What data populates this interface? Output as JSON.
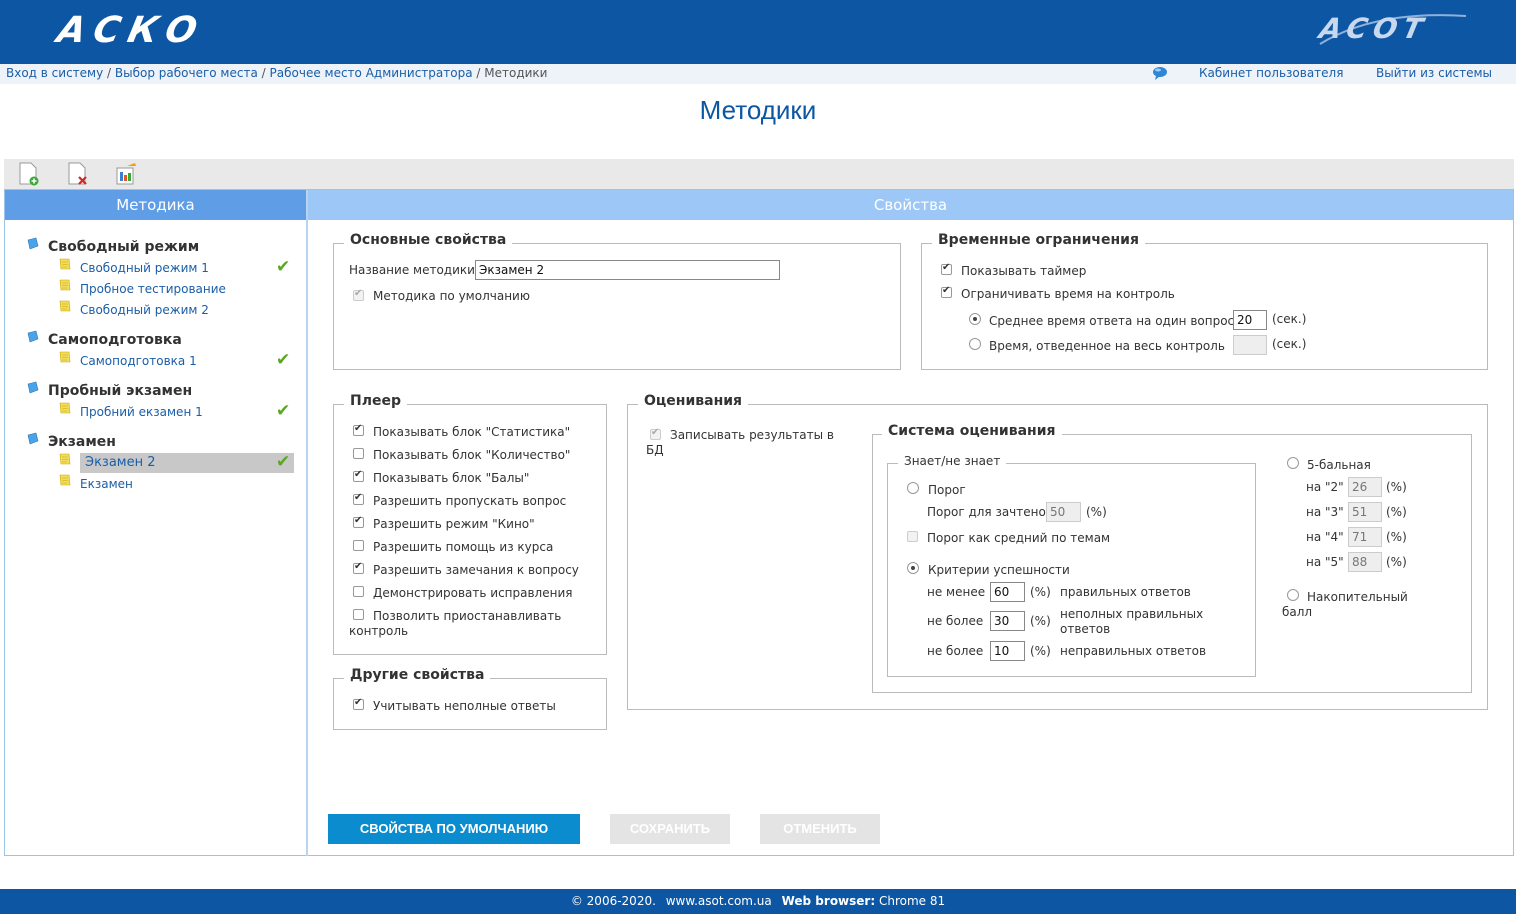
{
  "header": {
    "logo_left": "АСКО",
    "logo_right": "ACOT"
  },
  "breadcrumb": {
    "items": [
      "Вход в систему",
      "Выбор рабочего места",
      "Рабочее место Администратора"
    ],
    "current": "Методики",
    "separator": "/"
  },
  "nav": {
    "cabinet": "Кабинет пользователя",
    "logout": "Выйти из системы"
  },
  "page_title": "Методики",
  "panels": {
    "left_header": "Методика",
    "right_header": "Свойства"
  },
  "tree": [
    {
      "group": "Свободный режим",
      "items": [
        {
          "label": "Свободный режим 1",
          "checked": true
        },
        {
          "label": "Пробное тестирование",
          "checked": false
        },
        {
          "label": "Свободный режим 2",
          "checked": false
        }
      ]
    },
    {
      "group": "Самоподготовка",
      "items": [
        {
          "label": "Самоподготовка 1",
          "checked": true
        }
      ]
    },
    {
      "group": "Пробный экзамен",
      "items": [
        {
          "label": "Пробний екзамен 1",
          "checked": true
        }
      ]
    },
    {
      "group": "Экзамен",
      "items": [
        {
          "label": "Экзамен 2",
          "checked": true,
          "selected": true
        },
        {
          "label": "Екзамен",
          "checked": false
        }
      ]
    }
  ],
  "basic": {
    "title": "Основные свойства",
    "name_label": "Название методики",
    "name_value": "Экзамен 2",
    "default_label": "Методика по умолчанию",
    "default_checked": true
  },
  "time": {
    "title": "Временные ограничения",
    "show_timer": "Показывать таймер",
    "limit_time": "Ограничивать время на контроль",
    "avg_label": "Среднее время ответа на один вопрос",
    "avg_value": "20",
    "total_label": "Время, отведенное на весь контроль",
    "total_value": "",
    "unit": "(сек.)"
  },
  "player": {
    "title": "Плеер",
    "options": [
      {
        "label": "Показывать блок \"Статистика\"",
        "checked": true
      },
      {
        "label": "Показывать блок \"Количество\"",
        "checked": false
      },
      {
        "label": "Показывать блок \"Балы\"",
        "checked": true
      },
      {
        "label": "Разрешить пропускать вопрос",
        "checked": true
      },
      {
        "label": "Разрешить режим \"Кино\"",
        "checked": true
      },
      {
        "label": "Разрешить помощь из курса",
        "checked": false
      },
      {
        "label": "Разрешить замечания к вопросу",
        "checked": true
      },
      {
        "label": "Демонстрировать исправления",
        "checked": false
      }
    ],
    "pause_line1": "Позволить приостанавливать",
    "pause_line2": "контроль",
    "pause_checked": false
  },
  "other": {
    "title": "Другие свойства",
    "incomplete": "Учитывать неполные ответы",
    "incomplete_checked": true
  },
  "grading": {
    "title": "Оценивания",
    "record_line1": "Записывать результаты в",
    "record_line2": "БД",
    "system_title": "Система оценивания",
    "knows_title": "Знает/не знает",
    "threshold": "Порог",
    "threshold_pass": "Порог для зачтено",
    "threshold_value": "50",
    "percent": "(%)",
    "threshold_avg": "Порог как средний по темам",
    "criteria": "Критерии успешности",
    "not_less": "не менее",
    "not_more": "не более",
    "c1_value": "60",
    "c1_text": "правильных ответов",
    "c2_value": "30",
    "c2_line1": "неполных правильных",
    "c2_line2": "ответов",
    "c3_value": "10",
    "c3_text": "неправильных ответов",
    "five_point": "5-бальная",
    "grades": [
      {
        "label": "на \"2\"",
        "value": "26"
      },
      {
        "label": "на \"3\"",
        "value": "51"
      },
      {
        "label": "на \"4\"",
        "value": "71"
      },
      {
        "label": "на \"5\"",
        "value": "88"
      }
    ],
    "cumulative_line1": "Накопительный",
    "cumulative_line2": "балл"
  },
  "buttons": {
    "defaults": "СВОЙСТВА ПО УМОЛЧАНИЮ",
    "save": "СОХРАНИТЬ",
    "cancel": "ОТМЕНИТЬ"
  },
  "footer": {
    "copyright": "© 2006-2020.",
    "site": "www.asot.com.ua",
    "browser_label": "Web browser:",
    "browser_value": "Chrome 81"
  },
  "colors": {
    "brand_blue": "#0d56a3",
    "primary_button": "#0a8ccf",
    "check_green": "#5aa81e"
  }
}
